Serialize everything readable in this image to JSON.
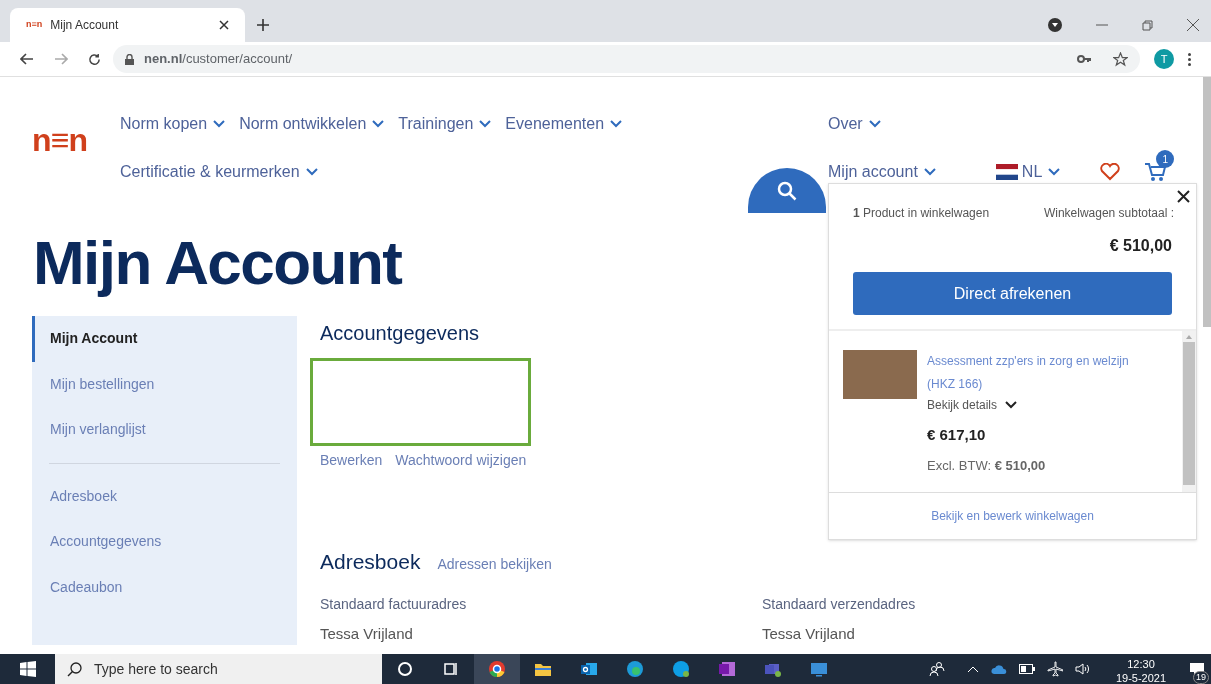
{
  "browser": {
    "favicon_text": "n≡n",
    "tab_title": "Mijn Account",
    "url": "**nen.nl**/customer/account/",
    "avatar_letter": "T"
  },
  "nav": {
    "logo_text": "n≡n",
    "row1": [
      "Norm kopen",
      "Norm ontwikkelen",
      "Trainingen",
      "Evenementen"
    ],
    "row2": [
      "Certificatie & keurmerken"
    ],
    "right_row1": "Over",
    "right_row2": "Mijn account",
    "language": "NL",
    "cart_count": "1"
  },
  "heading": "Mijn Account",
  "sidebar": {
    "groups": [
      [
        {
          "label": "Mijn Account",
          "selected": true
        },
        {
          "label": "Mijn bestellingen",
          "selected": false
        },
        {
          "label": "Mijn verlanglijst",
          "selected": false
        }
      ],
      [
        {
          "label": "Adresboek",
          "selected": false
        },
        {
          "label": "Accountgegevens",
          "selected": false
        },
        {
          "label": "Cadeaubon",
          "selected": false
        }
      ]
    ]
  },
  "account": {
    "title": "Accountgegevens",
    "links": [
      "Bewerken",
      "Wachtwoord wijzigen"
    ]
  },
  "address_book": {
    "title": "Adresboek",
    "link": "Adressen bekijken",
    "columns": [
      {
        "label": "Standaard factuuradres",
        "name": "Tessa Vrijland"
      },
      {
        "label": "Standaard verzendadres",
        "name": "Tessa Vrijland"
      }
    ]
  },
  "cart_popup": {
    "count_text": "**1** Product in winkelwagen",
    "subtotal_label": "Winkelwagen subtotaal :",
    "subtotal": "€ 510,00",
    "checkout": "Direct afrekenen",
    "item": {
      "title": "Assessment zzp'ers in zorg en welzijn (HKZ 166)",
      "details": "Bekijk details",
      "price": "€ 617,10",
      "excl": "Excl. BTW: **€ 510,00**"
    },
    "footer_link": "Bekijk en bewerk winkelwagen"
  },
  "taskbar": {
    "search_placeholder": "Type here to search",
    "time": "12:30",
    "date": "19-5-2021",
    "notifications": "19"
  }
}
